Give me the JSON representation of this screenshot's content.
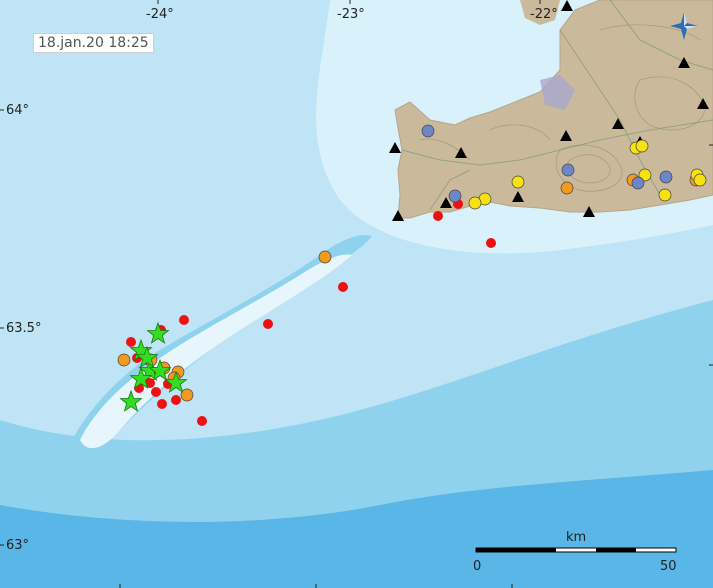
{
  "timestamp": "18.jan.20  18:25",
  "longitude_ticks": [
    "-24°",
    "-23°",
    "-22°"
  ],
  "latitude_ticks": [
    "64°",
    "63.5°",
    "63°"
  ],
  "scale_bar": {
    "unit": "km",
    "labels": [
      "0",
      "50"
    ]
  },
  "colors": {
    "sea_shallow": "#e6f6fc",
    "sea_light": "#bfe4f6",
    "sea_mid": "#8fd2ee",
    "sea_deep": "#5ab6e6",
    "land": "#cbb99c",
    "earthquake_red": "#ee1111",
    "earthquake_orange": "#f39a1e",
    "earthquake_yellow": "#f7e10e",
    "earthquake_blue": "#6e86c6",
    "large_event_star": "#33dd22",
    "station": "#000000"
  },
  "icons": {
    "station": "triangle-station-icon",
    "large_event": "star-icon",
    "compass": "compass-icon"
  }
}
